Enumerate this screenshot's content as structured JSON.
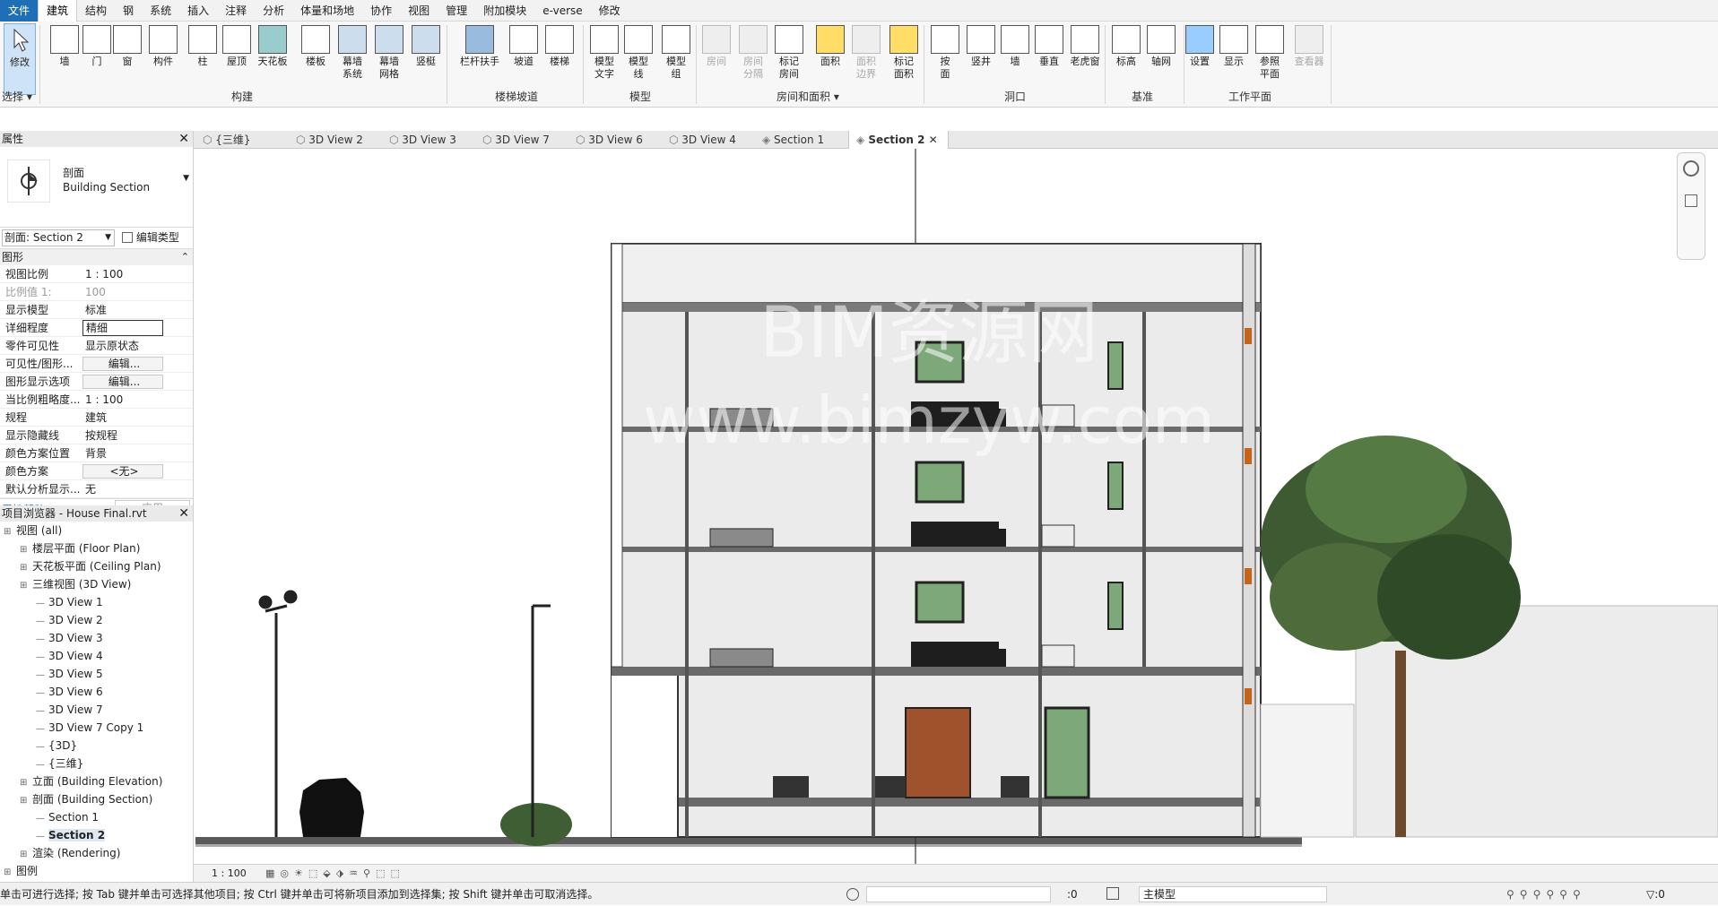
{
  "menubar": [
    "文件",
    "建筑",
    "结构",
    "钢",
    "系统",
    "插入",
    "注释",
    "分析",
    "体量和场地",
    "协作",
    "视图",
    "管理",
    "附加模块",
    "e-verse",
    "修改"
  ],
  "ribbon": {
    "tools": {
      "modify": "修改",
      "wall": "墙",
      "door": "门",
      "window": "窗",
      "component": "构件",
      "column": "柱",
      "roof": "屋顶",
      "ceiling": "天花板",
      "floor": "楼板",
      "curtain_system": "幕墙\n系统",
      "curtain_grid": "幕墙\n网格",
      "mullion": "竖梃",
      "railing": "栏杆扶手",
      "ramp": "坡道",
      "stair": "楼梯",
      "model_text": "模型\n文字",
      "model_line": "模型\n线",
      "model_group": "模型\n组",
      "room": "房间",
      "room_sep": "房间\n分隔",
      "tag_room": "标记\n房间",
      "area": "面积",
      "area_boundary": "面积\n边界",
      "tag_area": "标记\n面积",
      "by_face": "按\n面",
      "shaft": "竖井",
      "wall_opening": "墙",
      "vertical": "垂直",
      "dormer": "老虎窗",
      "level": "标高",
      "grid": "轴网",
      "set": "设置",
      "show": "显示",
      "ref_plane": "参照\n平面",
      "viewer": "查看器"
    },
    "panels": {
      "select": "选择",
      "build": "构建",
      "circulation": "楼梯坡道",
      "model": "模型",
      "room_area": "房间和面积",
      "opening": "洞口",
      "datum": "基准",
      "work_plane": "工作平面"
    }
  },
  "properties": {
    "title": "属性",
    "type_name": "剖面",
    "type_sub": "Building Section",
    "instance": "剖面: Section 2",
    "edit_type": "编辑类型",
    "group": "图形",
    "rows": [
      {
        "k": "视图比例",
        "v": "1 : 100"
      },
      {
        "k": "比例值 1:",
        "v": "100"
      },
      {
        "k": "显示模型",
        "v": "标准"
      },
      {
        "k": "详细程度",
        "v": "精细"
      },
      {
        "k": "零件可见性",
        "v": "显示原状态"
      },
      {
        "k": "可见性/图形...",
        "v": "编辑..."
      },
      {
        "k": "图形显示选项",
        "v": "编辑..."
      },
      {
        "k": "当比例粗略度...",
        "v": "1 : 100"
      },
      {
        "k": "规程",
        "v": "建筑"
      },
      {
        "k": "显示隐藏线",
        "v": "按规程"
      },
      {
        "k": "颜色方案位置",
        "v": "背景"
      },
      {
        "k": "颜色方案",
        "v": "<无>"
      },
      {
        "k": "默认分析显示...",
        "v": "无"
      }
    ],
    "help": "属性帮助",
    "apply": "应用"
  },
  "browser": {
    "title": "项目浏览器 - House Final.rvt",
    "nodes": [
      {
        "t": "视图 (all)",
        "lvl": 0
      },
      {
        "t": "楼层平面 (Floor Plan)",
        "lvl": 1
      },
      {
        "t": "天花板平面 (Ceiling Plan)",
        "lvl": 1
      },
      {
        "t": "三维视图 (3D View)",
        "lvl": 1
      },
      {
        "t": "3D View 1",
        "lvl": 2
      },
      {
        "t": "3D View 2",
        "lvl": 2
      },
      {
        "t": "3D View 3",
        "lvl": 2
      },
      {
        "t": "3D View 4",
        "lvl": 2
      },
      {
        "t": "3D View 5",
        "lvl": 2
      },
      {
        "t": "3D View 6",
        "lvl": 2
      },
      {
        "t": "3D View 7",
        "lvl": 2
      },
      {
        "t": "3D View 7 Copy 1",
        "lvl": 2
      },
      {
        "t": "{3D}",
        "lvl": 2
      },
      {
        "t": "{三维}",
        "lvl": 2
      },
      {
        "t": "立面 (Building Elevation)",
        "lvl": 1
      },
      {
        "t": "剖面 (Building Section)",
        "lvl": 1
      },
      {
        "t": "Section 1",
        "lvl": 2
      },
      {
        "t": "Section 2",
        "lvl": 2,
        "sel": true
      },
      {
        "t": "渲染 (Rendering)",
        "lvl": 1
      },
      {
        "t": "图例",
        "lvl": 0
      }
    ]
  },
  "tabs": [
    "{三维}",
    "3D View 2",
    "3D View 3",
    "3D View 7",
    "3D View 6",
    "3D View 4",
    "Section 1",
    "Section 2"
  ],
  "watermark": {
    "line1": "BIM资源网",
    "line2": "www.bimzyw.com"
  },
  "viewbar": {
    "scale": "1 : 100"
  },
  "status": {
    "text": "单击可进行选择; 按 Tab 键并单击可选择其他项目; 按 Ctrl 键并单击可将新项目添加到选择集; 按 Shift 键并单击可取消选择。",
    "count": ":0",
    "model": "主模型",
    "filter": ":0"
  }
}
